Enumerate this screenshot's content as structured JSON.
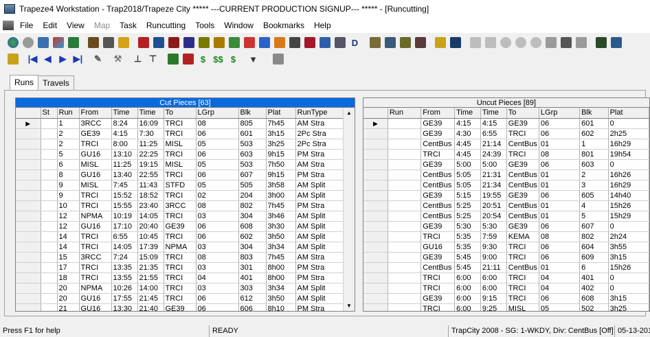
{
  "window": {
    "title": "Trapeze4 Workstation - Trap2018/Trapeze City   *****   ---CURRENT PRODUCTION SIGNUP---   *****  - [Runcutting]"
  },
  "menu": [
    {
      "label": "File",
      "enabled": true
    },
    {
      "label": "Edit",
      "enabled": true
    },
    {
      "label": "View",
      "enabled": true
    },
    {
      "label": "Map",
      "enabled": false
    },
    {
      "label": "Task",
      "enabled": true
    },
    {
      "label": "Runcutting",
      "enabled": true
    },
    {
      "label": "Tools",
      "enabled": true
    },
    {
      "label": "Window",
      "enabled": true
    },
    {
      "label": "Bookmarks",
      "enabled": true
    },
    {
      "label": "Help",
      "enabled": true
    }
  ],
  "tabs": [
    {
      "label": "Runs",
      "active": true
    },
    {
      "label": "Travels",
      "active": false
    }
  ],
  "cut": {
    "title": "Cut Pieces [63]",
    "columns": [
      "St",
      "Run",
      "From",
      "Time",
      "Time",
      "To",
      "LGrp",
      "Blk",
      "Plat",
      "RunType"
    ],
    "rows": [
      [
        "",
        "1",
        "3RCC",
        "8:24",
        "16:09",
        "TRCI",
        "08",
        "805",
        "7h45",
        "AM Stra"
      ],
      [
        "",
        "2",
        "GE39",
        "4:15",
        "7:30",
        "TRCI",
        "06",
        "601",
        "3h15",
        "2Pc Stra"
      ],
      [
        "",
        "2",
        "TRCI",
        "8:00",
        "11:25",
        "MISL",
        "05",
        "503",
        "3h25",
        "2Pc Stra"
      ],
      [
        "",
        "5",
        "GU16",
        "13:10",
        "22:25",
        "TRCI",
        "06",
        "603",
        "9h15",
        "PM Stra"
      ],
      [
        "",
        "6",
        "MISL",
        "11:25",
        "19:15",
        "MISL",
        "05",
        "503",
        "7h50",
        "AM Stra"
      ],
      [
        "",
        "8",
        "GU16",
        "13:40",
        "22:55",
        "TRCI",
        "06",
        "607",
        "9h15",
        "PM Stra"
      ],
      [
        "",
        "9",
        "MISL",
        "7:45",
        "11:43",
        "STFD",
        "05",
        "505",
        "3h58",
        "AM Split"
      ],
      [
        "",
        "9",
        "TRCI",
        "15:52",
        "18:52",
        "TRCI",
        "02",
        "204",
        "3h00",
        "AM Split"
      ],
      [
        "",
        "10",
        "TRCI",
        "15:55",
        "23:40",
        "3RCC",
        "08",
        "802",
        "7h45",
        "PM Stra"
      ],
      [
        "",
        "12",
        "NPMA",
        "10:19",
        "14:05",
        "TRCI",
        "03",
        "304",
        "3h46",
        "AM Split"
      ],
      [
        "",
        "12",
        "GU16",
        "17:10",
        "20:40",
        "GE39",
        "06",
        "608",
        "3h30",
        "AM Split"
      ],
      [
        "",
        "14",
        "TRCI",
        "6:55",
        "10:45",
        "TRCI",
        "06",
        "602",
        "3h50",
        "AM Split"
      ],
      [
        "",
        "14",
        "TRCI",
        "14:05",
        "17:39",
        "NPMA",
        "03",
        "304",
        "3h34",
        "AM Split"
      ],
      [
        "",
        "15",
        "3RCC",
        "7:24",
        "15:09",
        "TRCI",
        "08",
        "803",
        "7h45",
        "AM Stra"
      ],
      [
        "",
        "17",
        "TRCI",
        "13:35",
        "21:35",
        "TRCI",
        "03",
        "301",
        "8h00",
        "PM Stra"
      ],
      [
        "",
        "18",
        "TRCI",
        "13:55",
        "21:55",
        "TRCI",
        "04",
        "401",
        "8h00",
        "PM Stra"
      ],
      [
        "",
        "20",
        "NPMA",
        "10:26",
        "14:00",
        "TRCI",
        "03",
        "303",
        "3h34",
        "AM Split"
      ],
      [
        "",
        "20",
        "GU16",
        "17:55",
        "21:45",
        "TRCI",
        "06",
        "612",
        "3h50",
        "AM Split"
      ],
      [
        "",
        "21",
        "GU16",
        "13:30",
        "21:40",
        "GE39",
        "06",
        "606",
        "8h10",
        "PM Stra"
      ]
    ]
  },
  "uncut": {
    "title": "Uncut Pieces [89]",
    "columns": [
      "Run",
      "From",
      "Time",
      "Time",
      "To",
      "LGrp",
      "Blk",
      "Plat"
    ],
    "rows": [
      [
        "",
        "GE39",
        "4:15",
        "4:15",
        "GE39",
        "06",
        "601",
        "0"
      ],
      [
        "",
        "GE39",
        "4:30",
        "6:55",
        "TRCI",
        "06",
        "602",
        "2h25"
      ],
      [
        "",
        "CentBus",
        "4:45",
        "21:14",
        "CentBus",
        "01",
        "1",
        "16h29"
      ],
      [
        "",
        "TRCI",
        "4:45",
        "24:39",
        "TRCI",
        "08",
        "801",
        "19h54"
      ],
      [
        "",
        "GE39",
        "5:00",
        "5:00",
        "GE39",
        "06",
        "603",
        "0"
      ],
      [
        "",
        "CentBus",
        "5:05",
        "21:31",
        "CentBus",
        "01",
        "2",
        "16h26"
      ],
      [
        "",
        "CentBus",
        "5:05",
        "21:34",
        "CentBus",
        "01",
        "3",
        "16h29"
      ],
      [
        "",
        "GE39",
        "5:15",
        "19:55",
        "GE39",
        "06",
        "605",
        "14h40"
      ],
      [
        "",
        "CentBus",
        "5:25",
        "20:51",
        "CentBus",
        "01",
        "4",
        "15h26"
      ],
      [
        "",
        "CentBus",
        "5:25",
        "20:54",
        "CentBus",
        "01",
        "5",
        "15h29"
      ],
      [
        "",
        "GE39",
        "5:30",
        "5:30",
        "GE39",
        "06",
        "607",
        "0"
      ],
      [
        "",
        "TRCI",
        "5:35",
        "7:59",
        "KEMA",
        "08",
        "802",
        "2h24"
      ],
      [
        "",
        "GU16",
        "5:35",
        "9:30",
        "TRCI",
        "06",
        "604",
        "3h55"
      ],
      [
        "",
        "GE39",
        "5:45",
        "9:00",
        "TRCI",
        "06",
        "609",
        "3h15"
      ],
      [
        "",
        "CentBus",
        "5:45",
        "21:11",
        "CentBus",
        "01",
        "6",
        "15h26"
      ],
      [
        "",
        "TRCI",
        "6:00",
        "6:00",
        "TRCI",
        "04",
        "401",
        "0"
      ],
      [
        "",
        "TRCI",
        "6:00",
        "6:00",
        "TRCI",
        "04",
        "402",
        "0"
      ],
      [
        "",
        "GE39",
        "6:00",
        "9:15",
        "TRCI",
        "06",
        "608",
        "3h15"
      ],
      [
        "",
        "TRCI",
        "6:00",
        "9:25",
        "MISL",
        "05",
        "502",
        "3h25"
      ]
    ]
  },
  "status": {
    "help": "Press F1 for help",
    "state": "READY",
    "context": "TrapCity 2008 - SG: 1-WKDY, Div: CentBus [Off]",
    "date": "05-13-201"
  },
  "colors": {
    "selected_header": "#0a6adf"
  }
}
